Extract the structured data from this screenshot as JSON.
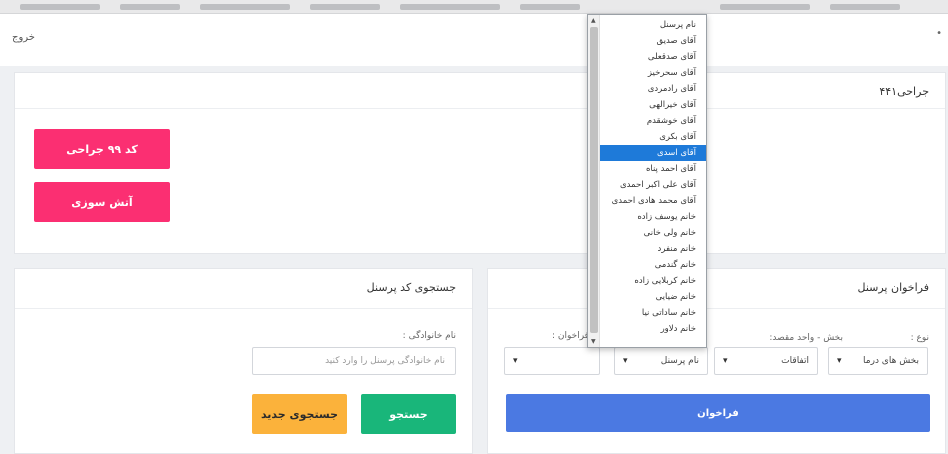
{
  "navbar": {
    "logout": "خروج"
  },
  "top_card": {
    "title": "جراحی۴۴۱",
    "buttons": [
      "کد ۹۹ جراحی",
      "آتش سوزی"
    ]
  },
  "call_card": {
    "title": "فراخوان پرسنل",
    "fields": {
      "type_label": "نوع :",
      "type_value": "بخش های درما",
      "dept_label": "بخش - واحد مقصد:",
      "dept_value": "اتفاقات",
      "staff_value": "نام پرسنل",
      "call_label": "فراخوان :",
      "call_value": ""
    },
    "submit": "فراخوان"
  },
  "search_card": {
    "title": "جستجوی کد پرسنل",
    "lastname_label": "نام خانوادگی :",
    "lastname_placeholder": "نام خانوادگی پرسنل را وارد کنید",
    "search_button": "جستجو",
    "new_search_button": "جستجوی جدید"
  },
  "dropdown": {
    "options": [
      "نام پرسنل",
      "آقای صدیق",
      "آقای صدقعلی",
      "آقای سحرخیز",
      "آقای رادمردی",
      "آقای خیرالهی",
      "آقای خوشقدم",
      "آقای بکری",
      "آقای اسدی",
      "آقای احمد پناه",
      "آقای علی اکبر احمدی",
      "آقای محمد هادی احمدی",
      "خانم یوسف زاده",
      "خانم ولی خانی",
      "خانم منفرد",
      "خانم گندمی",
      "خانم کربلایی زاده",
      "خانم ضیایی",
      "خانم ساداتی نیا",
      "خانم دلاور"
    ],
    "selected": "آقای اسدی"
  },
  "colors": {
    "pink": "#fb2f72",
    "blue": "#4b79e2",
    "green": "#19b67a",
    "yellow": "#fbb23b",
    "selected_option": "#1e7ad9"
  }
}
